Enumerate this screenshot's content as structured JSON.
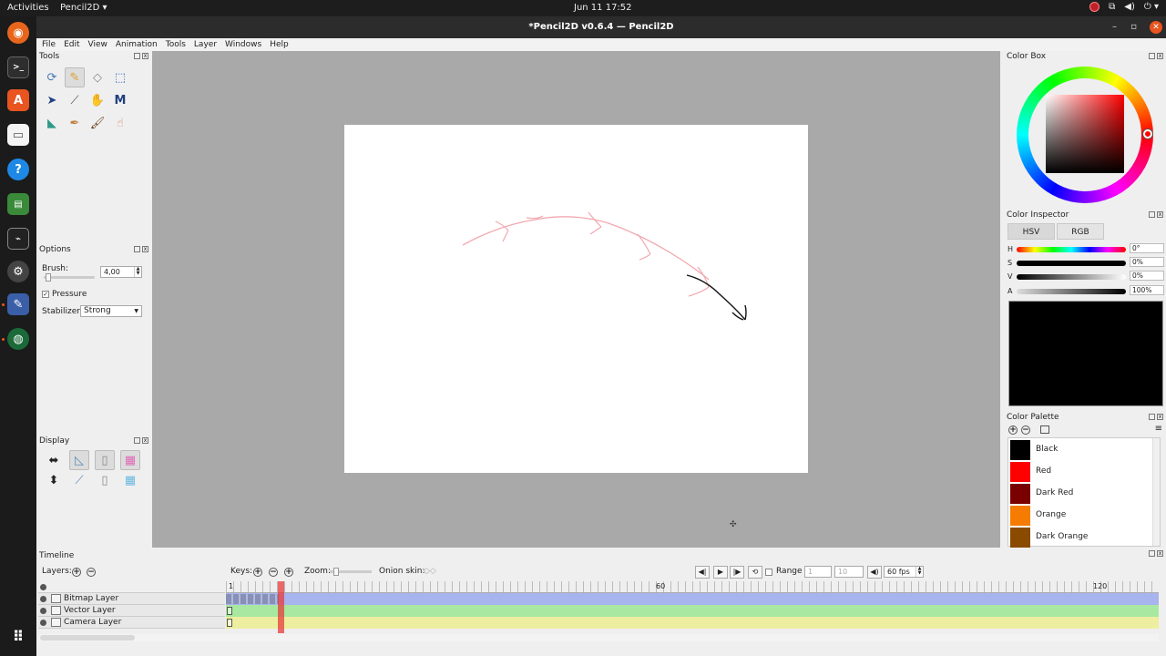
{
  "topbar": {
    "activities": "Activities",
    "app_menu": "Pencil2D ▾",
    "clock": "Jun 11  17:52",
    "tray_icons": [
      "network-icon",
      "volume-icon",
      "power-icon"
    ]
  },
  "window": {
    "title": "*Pencil2D v0.6.4 — Pencil2D"
  },
  "menu": [
    "File",
    "Edit",
    "View",
    "Animation",
    "Tools",
    "Layer",
    "Windows",
    "Help"
  ],
  "panels": {
    "tools": "Tools",
    "options": "Options",
    "display": "Display",
    "color_box": "Color Box",
    "color_inspector": "Color Inspector",
    "color_palette": "Color Palette",
    "timeline": "Timeline"
  },
  "options": {
    "brush_label": "Brush:",
    "brush_value": "4,00",
    "pressure_label": "Pressure",
    "pressure_checked": true,
    "stabilizer_label": "Stabilizer",
    "stabilizer_value": "Strong"
  },
  "inspector": {
    "tab_hsv": "HSV",
    "tab_rgb": "RGB",
    "h_label": "H",
    "h_value": "0°",
    "s_label": "S",
    "s_value": "0%",
    "v_label": "V",
    "v_value": "0%",
    "a_label": "A",
    "a_value": "100%",
    "current_color": "#000000"
  },
  "palette": [
    {
      "name": "Black",
      "color": "#000000"
    },
    {
      "name": "Red",
      "color": "#ff0000"
    },
    {
      "name": "Dark Red",
      "color": "#7a0000"
    },
    {
      "name": "Orange",
      "color": "#f57c00"
    },
    {
      "name": "Dark Orange",
      "color": "#8a4a00"
    }
  ],
  "timeline": {
    "layers_label": "Layers:",
    "keys_label": "Keys:",
    "zoom_label": "Zoom:",
    "onion_label": "Onion skin:",
    "range_label": "Range",
    "range_start": "1",
    "range_end": "10",
    "fps": "60 fps",
    "ruler_labels": [
      "1",
      "60",
      "120"
    ],
    "current_frame": 5,
    "layers": [
      {
        "name": "Bitmap Layer",
        "color": "#a8b4ee"
      },
      {
        "name": "Vector Layer",
        "color": "#a8e8a0"
      },
      {
        "name": "Camera Layer",
        "color": "#eeeea0"
      }
    ]
  }
}
